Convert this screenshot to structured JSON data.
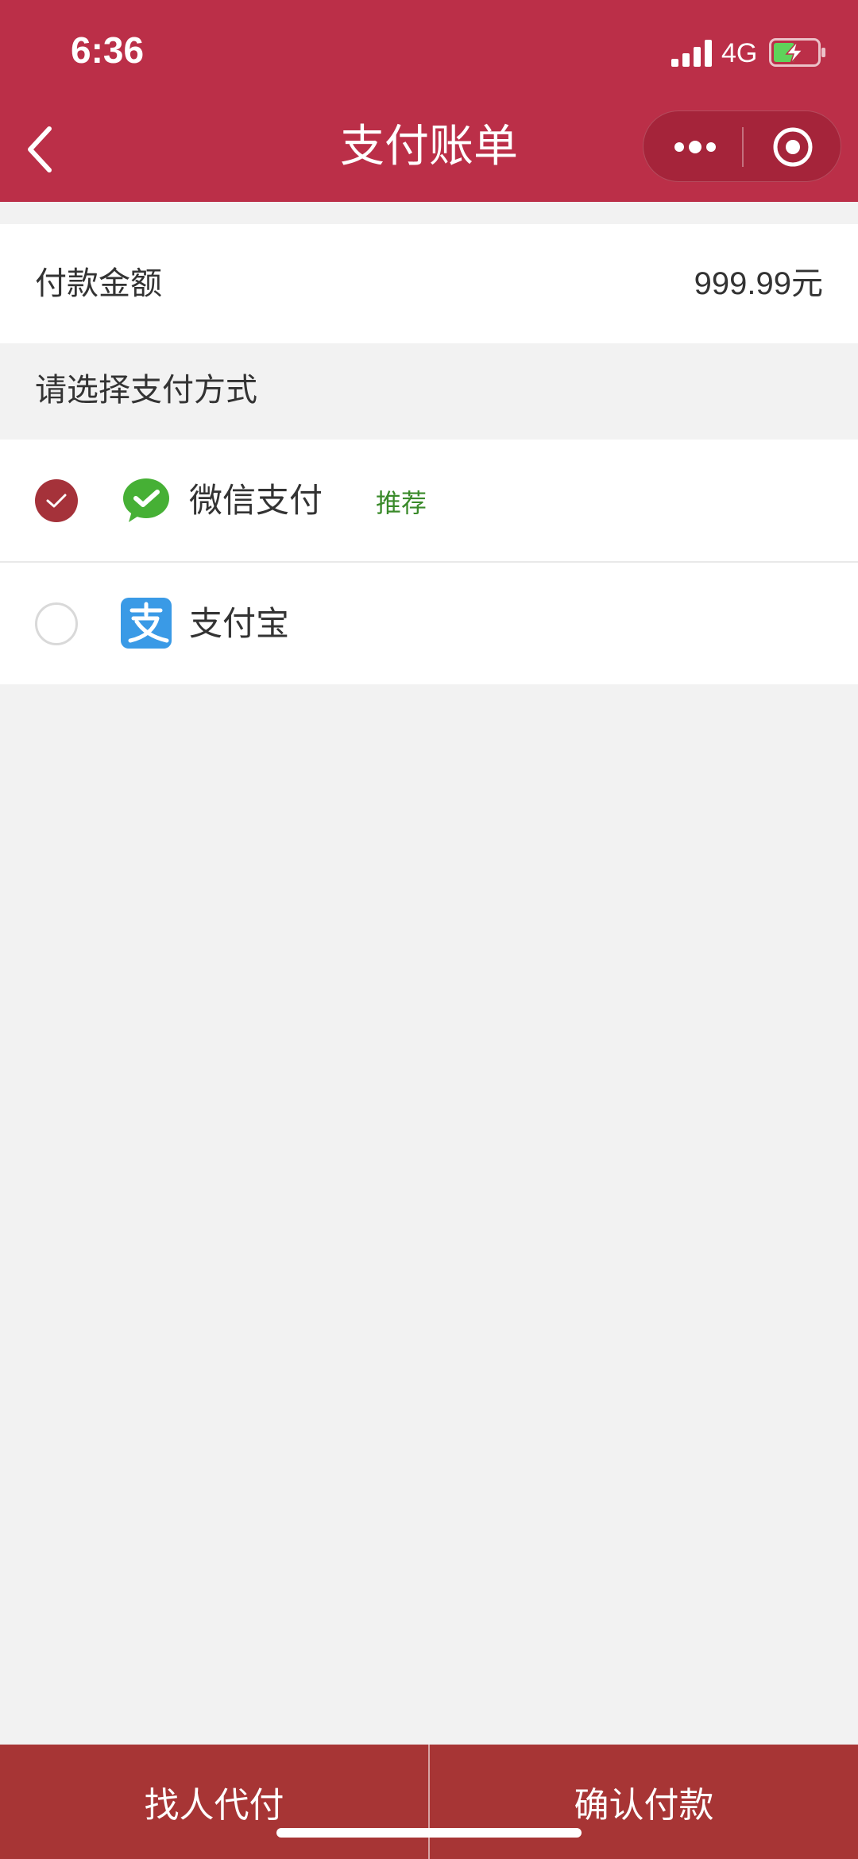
{
  "status_bar": {
    "time": "6:36",
    "network": "4G",
    "signal_icon": "cellular-signal-icon",
    "battery_icon": "battery-charging-icon"
  },
  "nav": {
    "title": "支付账单",
    "back_icon": "chevron-left-icon",
    "more_icon": "more-dots-icon",
    "close_icon": "mini-program-close-icon"
  },
  "amount": {
    "label": "付款金额",
    "value": "999.99元"
  },
  "payment_methods": {
    "section_title": "请选择支付方式",
    "items": [
      {
        "name": "微信支付",
        "badge": "推荐",
        "icon": "wechat-pay-icon",
        "selected": true
      },
      {
        "name": "支付宝",
        "icon": "alipay-icon",
        "selected": false
      }
    ]
  },
  "bottom_bar": {
    "left_label": "找人代付",
    "right_label": "确认付款"
  },
  "colors": {
    "header_bg": "#bb2f48",
    "bottom_bar_bg": "#a73535",
    "radio_checked": "#a5323a",
    "badge_text": "#3a8a2a",
    "wechat_green": "#46b035",
    "alipay_blue": "#3a9ae6",
    "page_bg": "#f2f2f2"
  }
}
